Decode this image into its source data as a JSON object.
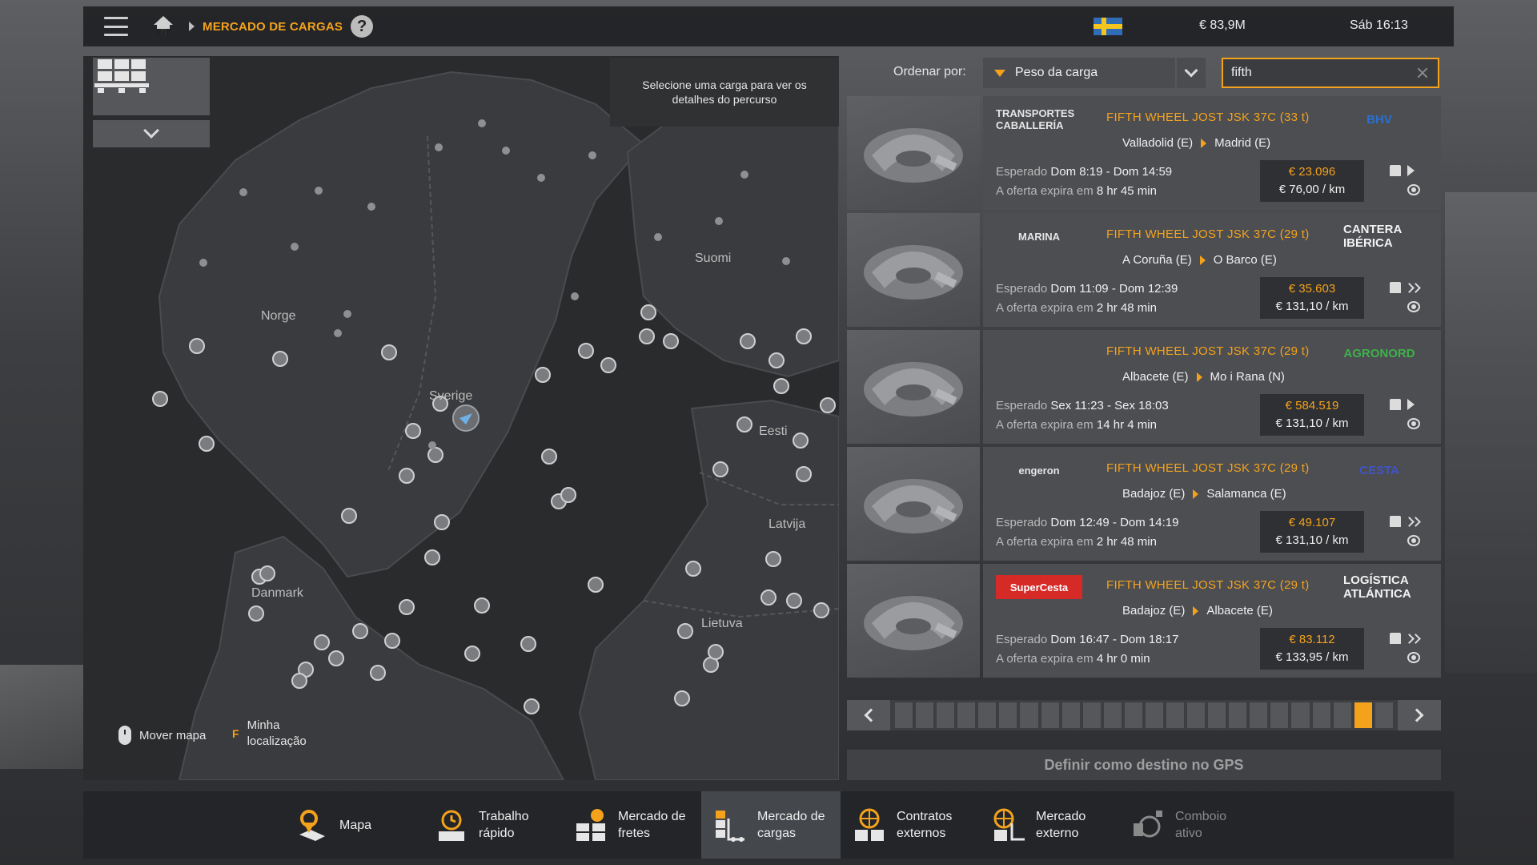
{
  "header": {
    "breadcrumb": "MERCADO DE CARGAS",
    "help": "?",
    "money": "€ 83,9M",
    "clock": "Sáb 16:13"
  },
  "map": {
    "route_hint": "Selecione uma carga para ver os detalhes do percurso",
    "labels": [
      "Norge",
      "Sverige",
      "Suomi",
      "Eesti",
      "Latvija",
      "Danmark",
      "Lietuva"
    ],
    "move_map": "Mover mapa",
    "key_f": "F",
    "my_location": "Minha localização"
  },
  "sort": {
    "label": "Ordenar por:",
    "value": "Peso da carga",
    "search_value": "fifth"
  },
  "jobs": [
    {
      "company": "TRANSPORTES CABALLERÍA",
      "cargo": "FIFTH WHEEL JOST JSK 37C (33 t)",
      "from": "Valladolid (E)",
      "to": "Madrid (E)",
      "expected_label": "Esperado",
      "expected": "Dom 8:19 - Dom 14:59",
      "expire_label": "A oferta expira em",
      "expire": "8 hr 45 min",
      "price": "€ 23.096",
      "per_km": "€ 76,00 / km",
      "dest_company": "BHV",
      "urgent": false,
      "dest_color": "#2a6fd1"
    },
    {
      "company": "MARINA",
      "cargo": "FIFTH WHEEL JOST JSK 37C (29 t)",
      "from": "A Coruña (E)",
      "to": "O Barco (E)",
      "expected_label": "Esperado",
      "expected": "Dom 11:09 - Dom 12:39",
      "expire_label": "A oferta expira em",
      "expire": "2 hr 48 min",
      "price": "€ 35.603",
      "per_km": "€ 131,10 / km",
      "dest_company": "CANTERA IBÉRICA",
      "urgent": true,
      "dest_color": "#f2f2f2"
    },
    {
      "company": "",
      "cargo": "FIFTH WHEEL JOST JSK 37C (29 t)",
      "from": "Albacete (E)",
      "to": "Mo i Rana (N)",
      "expected_label": "Esperado",
      "expected": "Sex 11:23 - Sex 18:03",
      "expire_label": "A oferta expira em",
      "expire": "14 hr 4 min",
      "price": "€ 584.519",
      "per_km": "€ 131,10 / km",
      "dest_company": "AGRONORD",
      "urgent": false,
      "dest_color": "#3fb14a"
    },
    {
      "company": "engeron",
      "cargo": "FIFTH WHEEL JOST JSK 37C (29 t)",
      "from": "Badajoz (E)",
      "to": "Salamanca (E)",
      "expected_label": "Esperado",
      "expected": "Dom 12:49 - Dom 14:19",
      "expire_label": "A oferta expira em",
      "expire": "2 hr 48 min",
      "price": "€ 49.107",
      "per_km": "€ 131,10 / km",
      "dest_company": "CESTA",
      "urgent": true,
      "dest_color": "#3f54c9"
    },
    {
      "company": "SuperCesta",
      "cargo": "FIFTH WHEEL JOST JSK 37C (29 t)",
      "from": "Badajoz (E)",
      "to": "Albacete (E)",
      "expected_label": "Esperado",
      "expected": "Dom 16:47 - Dom 18:17",
      "expire_label": "A oferta expira em",
      "expire": "4 hr 0 min",
      "price": "€ 83.112",
      "per_km": "€ 133,95 / km",
      "dest_company": "LOGÍSTICA ATLÁNTICA",
      "urgent": true,
      "dest_color": "#f2f2f2"
    }
  ],
  "pager": {
    "pages": 24,
    "current": 23
  },
  "gps_button": "Definir como destino no GPS",
  "nav": [
    {
      "label": "Mapa",
      "icon": "map-pin-icon",
      "active": false,
      "enabled": true
    },
    {
      "label": "Trabalho rápido",
      "icon": "stopwatch-icon",
      "active": false,
      "enabled": true
    },
    {
      "label": "Mercado de fretes",
      "icon": "freight-market-icon",
      "active": false,
      "enabled": true
    },
    {
      "label": "Mercado de cargas",
      "icon": "cargo-market-icon",
      "active": true,
      "enabled": true
    },
    {
      "label": "Contratos externos",
      "icon": "globe-contracts-icon",
      "active": false,
      "enabled": true
    },
    {
      "label": "Mercado externo",
      "icon": "globe-truck-icon",
      "active": false,
      "enabled": true
    },
    {
      "label": "Comboio ativo",
      "icon": "convoy-icon",
      "active": false,
      "enabled": false
    }
  ],
  "colors": {
    "accent": "#f4a21c",
    "panel": "#4c4e52",
    "map_bg": "#2a2b2d"
  }
}
